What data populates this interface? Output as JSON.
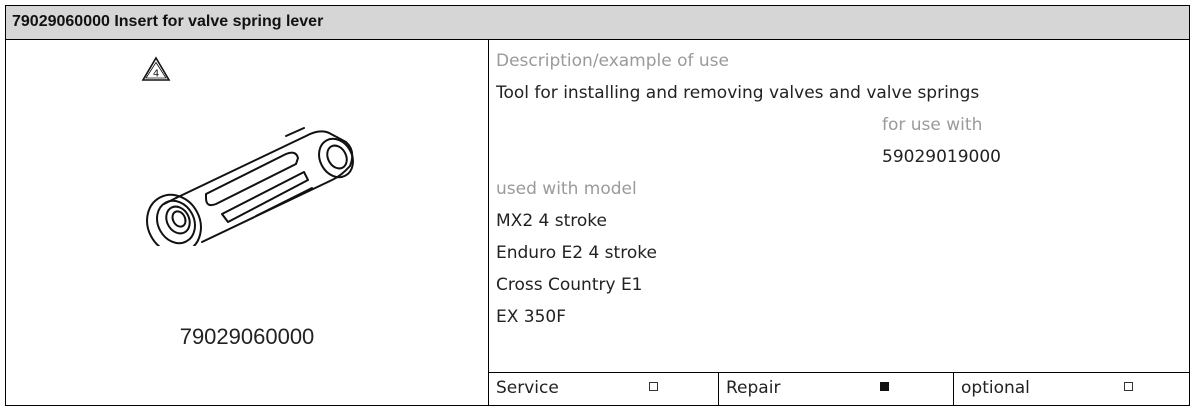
{
  "header": {
    "title": "79029060000 Insert for valve spring lever"
  },
  "left": {
    "warning_number": "4",
    "part_number": "79029060000"
  },
  "right": {
    "description_label": "Description/example of use",
    "description": "Tool for installing and removing valves and valve springs",
    "for_use_with_label": "for use with",
    "for_use_with": "59029019000",
    "used_with_model_label": "used with model",
    "models": [
      "MX2 4 stroke",
      "Enduro E2 4 stroke",
      "Cross Country E1",
      "EX 350F"
    ]
  },
  "options": [
    {
      "label": "Service",
      "checked": false
    },
    {
      "label": "Repair",
      "checked": true
    },
    {
      "label": "optional",
      "checked": false
    }
  ]
}
